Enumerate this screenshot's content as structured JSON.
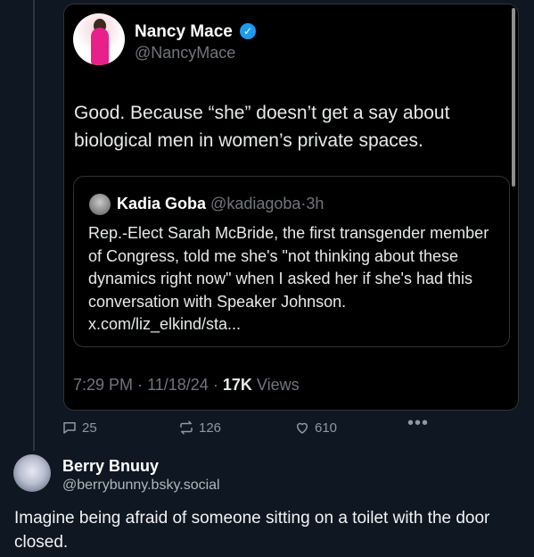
{
  "embedded_tweet": {
    "author_name": "Nancy Mace",
    "author_handle": "@NancyMace",
    "text": "Good. Because “she” doesn’t get a say about biological men in women’s private spaces.",
    "quoted": {
      "author_name": "Kadia Goba",
      "author_handle": "@kadiagoba",
      "separator": "·",
      "time": "3h",
      "text": "Rep.-Elect Sarah McBride, the first transgender member of Congress, told me she's \"not thinking about these dynamics right now\"  when I asked her if she's had this conversation with Speaker Johnson. x.com/liz_elkind/sta..."
    },
    "time": "7:29 PM",
    "date": "11/18/24",
    "separator": "·",
    "views_count": "17K",
    "views_label": "Views"
  },
  "actions": {
    "reply_count": "25",
    "repost_count": "126",
    "like_count": "610",
    "more_label": "•••"
  },
  "reply": {
    "author_name": "Berry Bnuuy",
    "author_handle": "@berrybunny.bsky.social",
    "text": "Imagine being afraid of someone sitting on a toilet with the door closed."
  },
  "colors": {
    "background": "#0f1722",
    "card": "#000000",
    "verified": "#1d9bf0",
    "muted": "#71767b"
  }
}
